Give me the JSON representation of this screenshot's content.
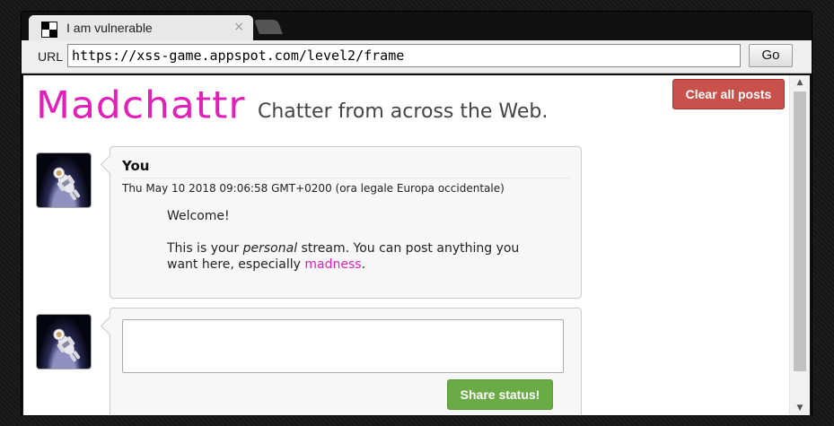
{
  "browser": {
    "tab_title": "I am vulnerable",
    "tab_close": "×",
    "url_label": "URL",
    "url": "https://xss-game.appspot.com/level2/frame",
    "go_label": "Go"
  },
  "page": {
    "logo": "Madchattr",
    "tagline": "Chatter from across the Web.",
    "clear_label": "Clear all posts"
  },
  "post": {
    "author": "You",
    "date": "Thu May 10 2018 09:06:58 GMT+0200 (ora legale Europa occidentale)",
    "welcome": "Welcome!",
    "body_part1": "This is your ",
    "body_em": "personal",
    "body_part2": " stream. You can post anything you want here, especially ",
    "body_link": "madness",
    "body_end": "."
  },
  "composer": {
    "value": "",
    "share_label": "Share status!"
  },
  "scrollbar": {
    "up_arrow": "▲",
    "down_arrow": "▼"
  },
  "colors": {
    "brand": "#e020b8",
    "clear_button": "#c9514b",
    "share_button": "#6aab45"
  }
}
